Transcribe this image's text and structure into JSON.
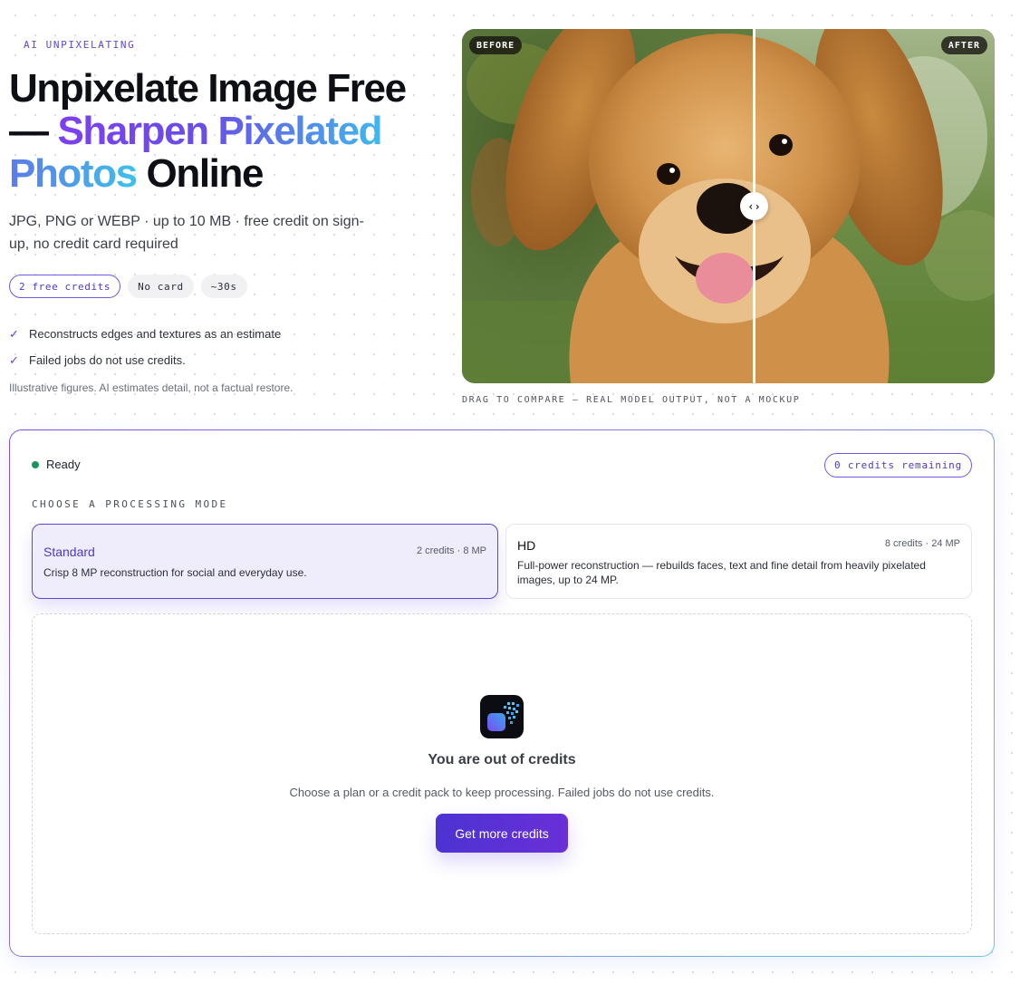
{
  "hero": {
    "eyebrow": "AI UNPIXELATING",
    "title_line1": "Unpixelate Image Free",
    "title_dash": "— ",
    "title_grad1": "Sharpen Pixelated",
    "title_grad2": "Photos",
    "title_end": " Online",
    "subtitle": "JPG, PNG or WEBP · up to 10 MB · free credit on sign-up, no credit card required",
    "pills": [
      "2 free credits",
      "No card",
      "~30s"
    ],
    "checks": [
      "Reconstructs edges and textures as an estimate",
      "Failed jobs do not use credits."
    ],
    "disclaimer": "Illustrative figures. AI estimates detail, not a factual restore."
  },
  "compare": {
    "before_label": "BEFORE",
    "after_label": "AFTER",
    "handle_glyph": "‹›",
    "caption": "DRAG TO COMPARE — REAL MODEL OUTPUT, NOT A MOCKUP"
  },
  "panel": {
    "status": "Ready",
    "credits": "0 credits remaining",
    "mode_heading": "CHOOSE A PROCESSING MODE",
    "modes": [
      {
        "name": "Standard",
        "meta": "2 credits · 8 MP",
        "desc": "Crisp 8 MP reconstruction for social and everyday use."
      },
      {
        "name": "HD",
        "meta": "8 credits · 24 MP",
        "desc": "Full-power reconstruction — rebuilds faces, text and fine detail from heavily pixelated images, up to 24 MP."
      }
    ],
    "empty": {
      "title": "You are out of credits",
      "desc": "Choose a plan or a credit pack to keep processing. Failed jobs do not use credits.",
      "cta": "Get more credits"
    }
  },
  "colors": {
    "accent": "#5a47cf",
    "status_ready": "#17965c"
  }
}
